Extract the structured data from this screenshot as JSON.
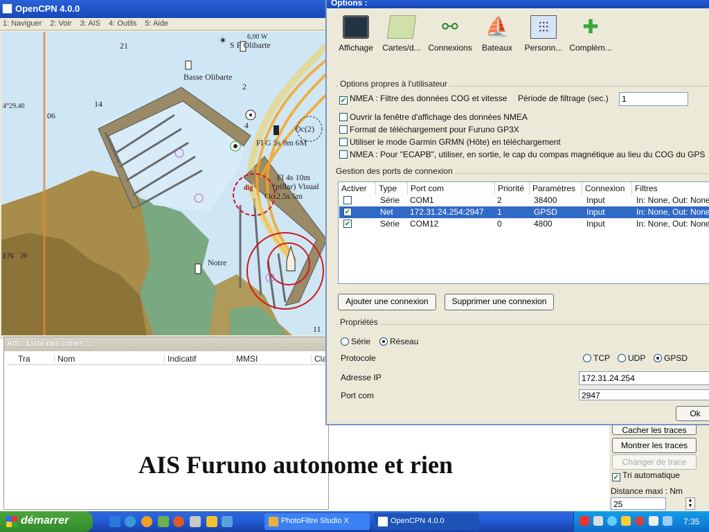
{
  "main_window": {
    "title": "OpenCPN 4.0.0",
    "menu": [
      "1: Naviguer",
      "2: Voir",
      "3: AIS",
      "4: Outils",
      "5: Aide"
    ]
  },
  "chart": {
    "labels": {
      "olibarte": "S F Olibarte",
      "basse_olibarte": "Basse Olibarte",
      "depth_6m": "6,00 W",
      "lat_29": "4°29.40",
      "depth_21": "21",
      "depth_14": "14",
      "depth_06": "06",
      "depth_2": "2",
      "depth_4": "4",
      "depth_11": "11",
      "oc": "Oc(2)",
      "light1": "Fl G 5s 9m 6M",
      "light2": "Fl 4s 10m",
      "light3": "(pillar) Visual",
      "light4": "Oc 2.5s 5m",
      "dig": "dig",
      "notre": "Notre",
      "en": "EN",
      "lat_20": "20"
    }
  },
  "ais_list": {
    "title": "AIS : Liste des cibles ...",
    "columns": [
      "Tra",
      "Nom",
      "Indicatif",
      "MMSI",
      "Class"
    ]
  },
  "caption": "AIS Furuno autonome et rien",
  "route_panel": {
    "hide_traces": "Cacher les traces",
    "show_traces": "Montrer les traces",
    "change_trace": "Changer de trace",
    "auto_sort_label": "Tri automatique",
    "auto_sort": true,
    "max_distance_label": "Distance maxi : Nm",
    "max_distance": "25"
  },
  "options": {
    "title": "Options :",
    "tabs": [
      {
        "label": "Affichage",
        "icon": "monitor-icon"
      },
      {
        "label": "Cartes/d...",
        "icon": "charts-icon"
      },
      {
        "label": "Connexions",
        "icon": "connections-icon"
      },
      {
        "label": "Bateaux",
        "icon": "boat-icon"
      },
      {
        "label": "Personn...",
        "icon": "sliders-icon"
      },
      {
        "label": "Complém...",
        "icon": "plugin-icon"
      }
    ],
    "user_group": {
      "title": "Options propres à l'utilisateur",
      "nmea_filter_label": "NMEA : Filtre des données COG et vitesse",
      "nmea_filter": true,
      "filter_period_label": "Période de filtrage (sec.)",
      "filter_period": "1",
      "open_nmea_label": "Ouvrir la fenêtre d'affichage des données NMEA",
      "furuno_label": "Format de téléchargement pour Furuno GP3X",
      "garmin_label": "Utiliser le mode Garmin GRMN (Hôte) en téléchargement",
      "ecapb_label": "NMEA : Pour \"ECAPB\", utiliser, en sortie, le cap du compas magnétique  au lieu du COG du GPS"
    },
    "ports_group": {
      "title": "Gestion des ports de connexion",
      "columns": [
        "Activer",
        "Type",
        "Port com",
        "Priorité",
        "Paramètres",
        "Connexion",
        "Filtres"
      ],
      "rows": [
        {
          "enabled": false,
          "type": "Série",
          "port": "COM1",
          "priority": "2",
          "params": "38400",
          "connection": "Input",
          "filters": "In: None, Out: None"
        },
        {
          "enabled": true,
          "type": "Net",
          "port": "172.31.24.254:2947",
          "priority": "1",
          "params": "GPSD",
          "connection": "Input",
          "filters": "In: None, Out: None"
        },
        {
          "enabled": true,
          "type": "Série",
          "port": "COM12",
          "priority": "0",
          "params": "4800",
          "connection": "Input",
          "filters": "In: None, Out: None"
        }
      ],
      "add_button": "Ajouter une connexion",
      "remove_button": "Supprimer une connexion"
    },
    "props_group": {
      "title": "Propriétés",
      "serial_label": "Série",
      "network_label": "Réseau",
      "protocol_label": "Protocole",
      "tcp": "TCP",
      "udp": "UDP",
      "gpsd": "GPSD",
      "ip_label": "Adresse IP",
      "ip_value": "172.31.24.254",
      "port_label": "Port com",
      "port_value": "2947"
    },
    "ok_button": "Ok"
  },
  "taskbar": {
    "start": "démarrer",
    "tasks": [
      "PhotoFiltre Studio X",
      "OpenCPN 4.0.0"
    ],
    "clock": "7:35"
  }
}
